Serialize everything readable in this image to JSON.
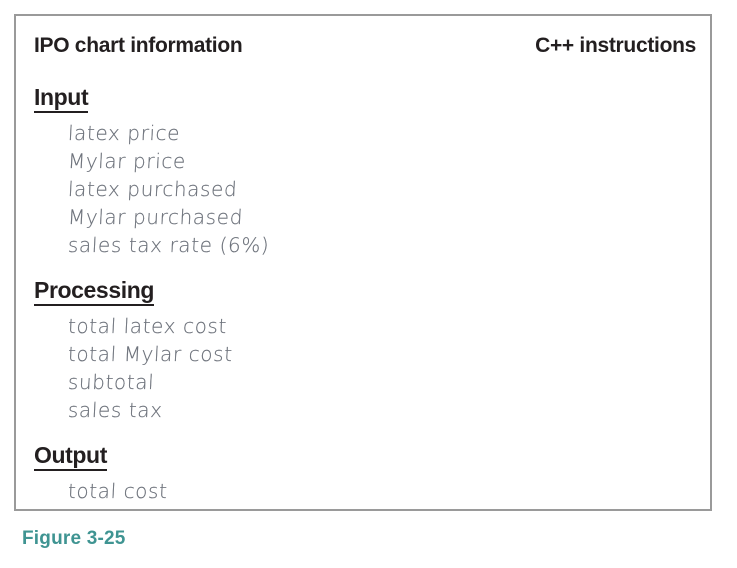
{
  "figure": {
    "caption": "Figure 3-25",
    "caption_color": "#3f9492",
    "border_color": "#9a9a9a",
    "heading_color": "#231f20",
    "item_color": "#6d727b"
  },
  "columns": {
    "left_header": "IPO chart information",
    "right_header": "C++ instructions"
  },
  "sections": [
    {
      "title": "Input",
      "items": [
        "latex price",
        "Mylar price",
        "latex purchased",
        "Mylar purchased",
        "sales tax rate (6%)"
      ]
    },
    {
      "title": "Processing",
      "items": [
        "total latex cost",
        "total Mylar cost",
        "subtotal",
        "sales tax"
      ]
    },
    {
      "title": "Output",
      "items": [
        "total cost"
      ]
    }
  ],
  "right_column_items": []
}
